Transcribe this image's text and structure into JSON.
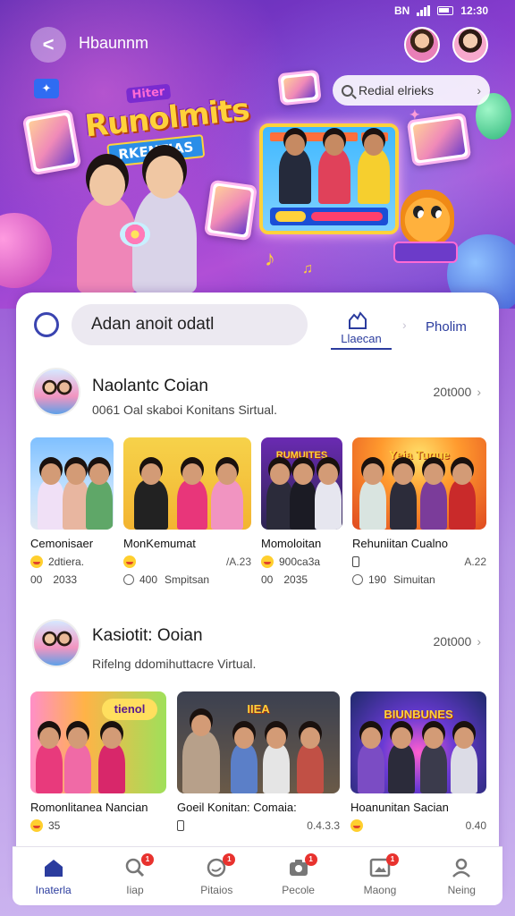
{
  "status": {
    "time": "12:30",
    "carrier": "BN"
  },
  "header": {
    "title": "Hbaunnm",
    "back_label": "<"
  },
  "hero": {
    "search_placeholder": "Redial elrieks",
    "logo_top": "Hiter",
    "logo_main": "Runolmits",
    "logo_sub": "RKENTIAS"
  },
  "panel": {
    "search_value": "Adan anoit odatl",
    "tab_active": "Llaecan",
    "tab_other": "Pholim"
  },
  "sections": [
    {
      "title": "Naolantc Coian",
      "subtitle": "0061 Oal skaboi Konitans Sirtual.",
      "count": "20t000",
      "tiles": [
        {
          "name": "Cemonisaer",
          "meta1_left": "2dtiera.",
          "meta1_right": "",
          "meta2_left": "00",
          "meta2_right": "2033",
          "row1_icon": "emoji"
        },
        {
          "name": "MonKemumat",
          "meta1_left": "",
          "meta1_right": "/A.23",
          "meta2_left": "400",
          "meta2_right": "Smpitsan",
          "row1_icon": "emoji"
        },
        {
          "name": "Momoloitan",
          "meta1_left": "900ca3a",
          "meta1_right": "",
          "meta2_left": "00",
          "meta2_right": "2035",
          "row1_icon": "emoji"
        },
        {
          "name": "Rehuniitan Cualno",
          "meta1_left": "",
          "meta1_right": "A.22",
          "meta2_left": "190",
          "meta2_right": "Simuitan",
          "row1_icon": "bar"
        }
      ]
    },
    {
      "title": "Kasiotit: Ooian",
      "subtitle": "Rifelng ddomihuttacre Virtual.",
      "count": "20t000",
      "tiles": [
        {
          "name": "Romonlitanea Nancian",
          "meta1_left": "35",
          "meta1_right": "",
          "row1_icon": "emoji"
        },
        {
          "name": "Goeil Konitan: Comaia:",
          "meta1_left": "",
          "meta1_right": "0.4.3.3",
          "row1_icon": "bar"
        },
        {
          "name": "Hoanunitan Sacian",
          "meta1_left": "",
          "meta1_right": "0.40",
          "row1_icon": "emoji"
        }
      ]
    }
  ],
  "tile_banners": [
    "RUMUITES",
    "Yeia Tuque",
    "tienol",
    "IIEA",
    "BIUNBUNES"
  ],
  "nav": [
    {
      "label": "Inaterla",
      "icon": "home-icon",
      "badge": ""
    },
    {
      "label": "Iiap",
      "icon": "search-icon",
      "badge": "1"
    },
    {
      "label": "Pitaios",
      "icon": "chat-icon",
      "badge": "1"
    },
    {
      "label": "Pecole",
      "icon": "camera-icon",
      "badge": "1"
    },
    {
      "label": "Maong",
      "icon": "gallery-icon",
      "badge": "1"
    },
    {
      "label": "Neing",
      "icon": "profile-icon",
      "badge": ""
    }
  ],
  "colors": {
    "accent": "#2b3c9e",
    "badge": "#e8322e",
    "background": "#9a5ad6"
  }
}
